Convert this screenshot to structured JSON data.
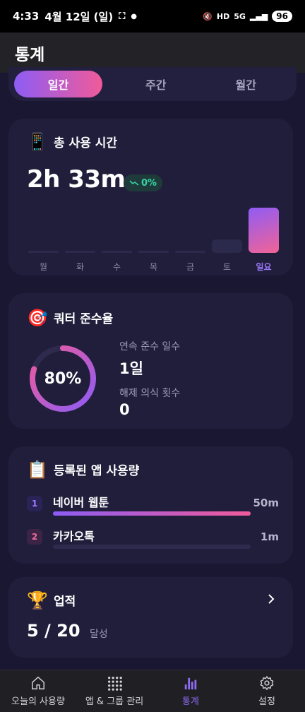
{
  "status": {
    "time": "4:33",
    "date": "4월 12일 (일)",
    "battery": "96"
  },
  "app_title": "통계",
  "period_tabs": [
    {
      "label": "일간",
      "active": true
    },
    {
      "label": "주간",
      "active": false
    },
    {
      "label": "월간",
      "active": false
    }
  ],
  "usage_card": {
    "title": "총 사용 시간",
    "icon": "mobile-phone-icon",
    "total": "2h 33m",
    "trend": "0%",
    "chart_data": {
      "type": "bar",
      "categories": [
        "월",
        "화",
        "수",
        "목",
        "금",
        "토",
        "일요"
      ],
      "values": [
        0,
        0,
        0,
        0,
        0,
        0.3,
        1.0
      ],
      "highlight_index": 6
    }
  },
  "quota_card": {
    "title": "쿼터 준수율",
    "icon": "target-icon",
    "rate_text": "80%",
    "rate_value": 0.8,
    "streak_label": "연속 준수 일수",
    "streak_value": "1일",
    "unlock_label": "해제 의식 횟수",
    "unlock_value": "0"
  },
  "apps_card": {
    "title": "등록된 앱 사용량",
    "icon": "clipboard-icon",
    "items": [
      {
        "rank": "1",
        "name": "네이버 웹툰",
        "value": "50m",
        "fraction": 1.0
      },
      {
        "rank": "2",
        "name": "카카오톡",
        "value": "1m",
        "fraction": 0.0
      }
    ]
  },
  "achievement_card": {
    "title": "업적",
    "icon": "trophy-icon",
    "progress": "5 / 20",
    "suffix": "달성"
  },
  "bottom_nav": [
    {
      "label": "오늘의 사용량",
      "icon": "home-icon",
      "active": false
    },
    {
      "label": "앱 & 그룹 관리",
      "icon": "grid-icon",
      "active": false
    },
    {
      "label": "통계",
      "icon": "bar-chart-icon",
      "active": true
    },
    {
      "label": "설정",
      "icon": "gear-icon",
      "active": false
    }
  ],
  "colors": {
    "accent_start": "#8d5cf5",
    "accent_end": "#f05b99",
    "background": "#1a1733",
    "card": "#211e3c",
    "trend_green": "#36d3a6"
  }
}
